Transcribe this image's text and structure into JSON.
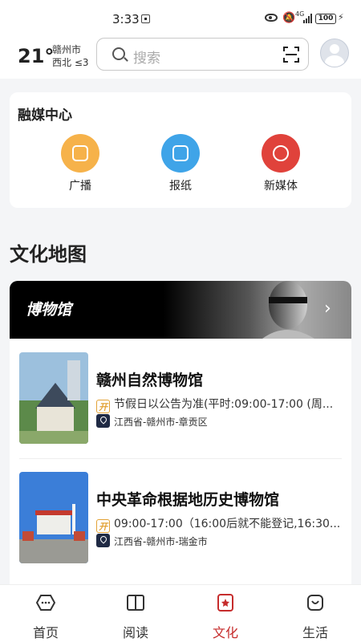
{
  "status_bar": {
    "time": "3:33",
    "network": "4G",
    "battery": "100"
  },
  "header": {
    "temperature": "21°",
    "city": "赣州市",
    "wind": "西北 ≤3",
    "search_placeholder": "搜索"
  },
  "media_center": {
    "title": "融媒中心",
    "items": [
      {
        "label": "广播",
        "icon": "radio-icon",
        "color": "#f6b24a"
      },
      {
        "label": "报纸",
        "icon": "newspaper-icon",
        "color": "#3fa4e8"
      },
      {
        "label": "新媒体",
        "icon": "new-media-icon",
        "color": "#e0423b"
      }
    ]
  },
  "culture_map": {
    "title": "文化地图",
    "banner_title": "博物馆",
    "museums": [
      {
        "name": "赣州自然博物馆",
        "hours": "节假日以公告为准(平时:09:00-17:00 (周...",
        "address": "江西省-赣州市-章贡区"
      },
      {
        "name": "中央革命根据地历史博物馆",
        "hours": "09:00-17:00（16:00后就不能登记,16:30...",
        "address": "江西省-赣州市-瑞金市"
      }
    ]
  },
  "bottom_nav": {
    "items": [
      {
        "label": "首页",
        "icon": "home-icon"
      },
      {
        "label": "阅读",
        "icon": "book-icon"
      },
      {
        "label": "文化",
        "icon": "culture-icon",
        "active": true
      },
      {
        "label": "生活",
        "icon": "life-icon"
      }
    ],
    "active_color": "#c62c2c"
  }
}
